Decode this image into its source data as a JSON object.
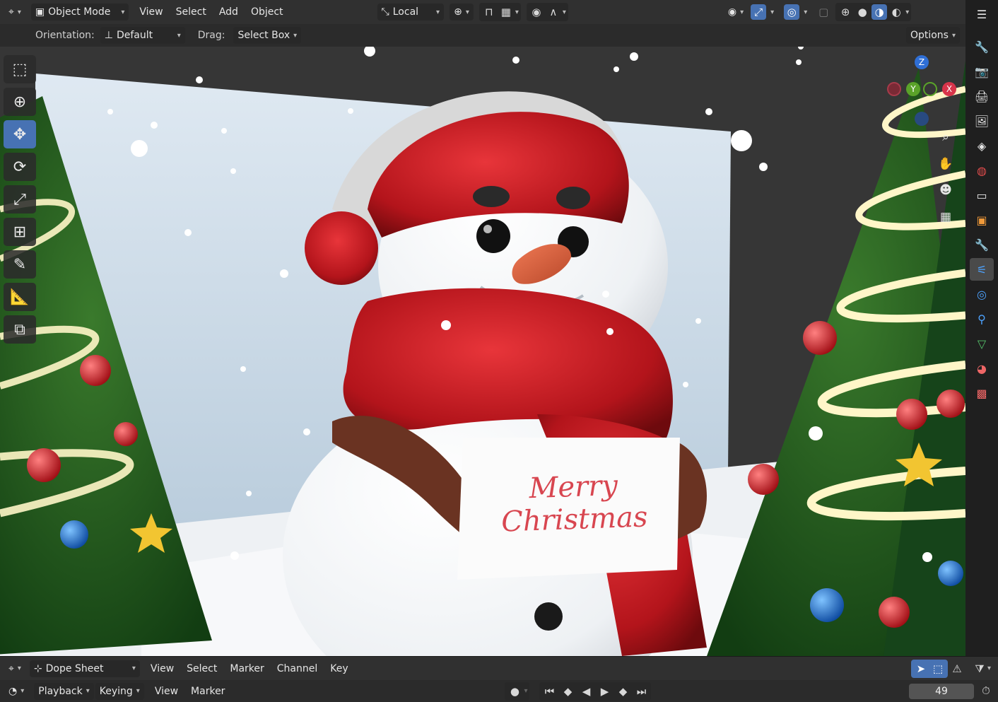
{
  "header": {
    "editor_icon": "editor-type-icon",
    "mode": "Object Mode",
    "menus": [
      "View",
      "Select",
      "Add",
      "Object"
    ],
    "transform_orientation": "Local",
    "options_label": "Options"
  },
  "tool_settings": {
    "orientation_label": "Orientation:",
    "orientation_value": "Default",
    "drag_label": "Drag:",
    "drag_value": "Select Box"
  },
  "viewport": {
    "card_text": "Merry Christmas",
    "gizmo_axes": [
      "Z",
      "Y",
      "X"
    ]
  },
  "toolbar_icons": [
    "select-box-icon",
    "cursor-icon",
    "move-icon",
    "rotate-icon",
    "scale-icon",
    "transform-icon",
    "annotate-icon",
    "measure-icon",
    "add-cube-icon"
  ],
  "properties_tabs": [
    "tool",
    "render",
    "output",
    "view-layer",
    "scene",
    "world",
    "collection",
    "object",
    "modifiers",
    "particles",
    "physics",
    "constraints",
    "data",
    "material",
    "texture"
  ],
  "timeline_header": {
    "editor": "Dope Sheet",
    "menus": [
      "View",
      "Select",
      "Marker",
      "Channel",
      "Key"
    ]
  },
  "playback_bar": {
    "menus": [
      "Playback",
      "Keying",
      "View",
      "Marker"
    ],
    "current_frame": "49"
  },
  "colors": {
    "accent": "#4772b3",
    "header": "#303030",
    "background": "#1d1d1d"
  }
}
